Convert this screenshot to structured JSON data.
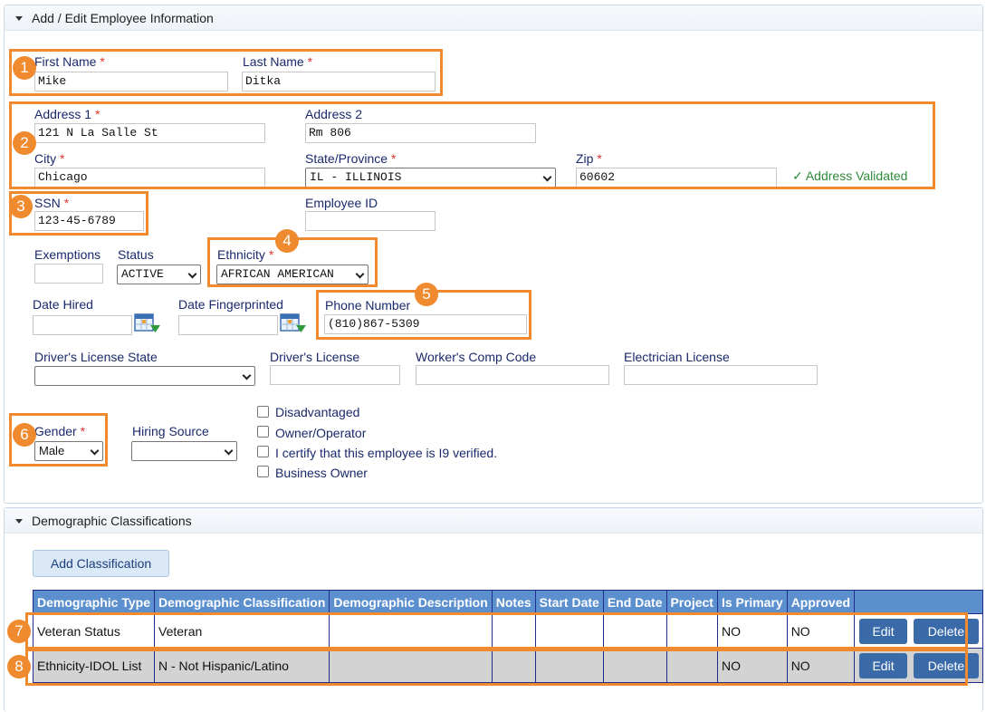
{
  "section1": {
    "title": "Add / Edit Employee Information"
  },
  "fields": {
    "first_name": {
      "label": "First Name",
      "value": "Mike"
    },
    "last_name": {
      "label": "Last Name",
      "value": "Ditka"
    },
    "address1": {
      "label": "Address 1",
      "value": "121 N La Salle St"
    },
    "address2": {
      "label": "Address 2",
      "value": "Rm 806"
    },
    "city": {
      "label": "City",
      "value": "Chicago"
    },
    "state": {
      "label": "State/Province",
      "value": "IL - ILLINOIS"
    },
    "zip": {
      "label": "Zip",
      "value": "60602"
    },
    "address_status": "✓ Address Validated",
    "ssn": {
      "label": "SSN",
      "value": "123-45-6789"
    },
    "employee_id": {
      "label": "Employee ID",
      "value": ""
    },
    "exemptions": {
      "label": "Exemptions",
      "value": ""
    },
    "status": {
      "label": "Status",
      "value": "ACTIVE"
    },
    "ethnicity": {
      "label": "Ethnicity",
      "value": "AFRICAN AMERICAN"
    },
    "date_hired": {
      "label": "Date Hired",
      "value": ""
    },
    "date_fingerprinted": {
      "label": "Date Fingerprinted",
      "value": ""
    },
    "phone": {
      "label": "Phone Number",
      "value": "(810)867-5309"
    },
    "dl_state": {
      "label": "Driver's License State",
      "value": ""
    },
    "dl": {
      "label": "Driver's License",
      "value": ""
    },
    "workers_comp": {
      "label": "Worker's Comp Code",
      "value": ""
    },
    "electrician": {
      "label": "Electrician License",
      "value": ""
    },
    "gender": {
      "label": "Gender",
      "value": "Male"
    },
    "hiring_source": {
      "label": "Hiring Source",
      "value": ""
    },
    "required_mark": "*"
  },
  "checkboxes": [
    {
      "label": "Disadvantaged",
      "checked": false
    },
    {
      "label": "Owner/Operator",
      "checked": false
    },
    {
      "label": "I certify that this employee is I9 verified.",
      "checked": false
    },
    {
      "label": "Business Owner",
      "checked": false
    }
  ],
  "section2": {
    "title": "Demographic Classifications",
    "add_button": "Add Classification",
    "columns": [
      "Demographic Type",
      "Demographic Classification",
      "Demographic Description",
      "Notes",
      "Start Date",
      "End Date",
      "Project",
      "Is Primary",
      "Approved"
    ],
    "rows": [
      {
        "type": "Veteran Status",
        "classification": "Veteran",
        "description": "",
        "notes": "",
        "start": "",
        "end": "",
        "project": "",
        "primary": "NO",
        "approved": "NO",
        "edit": "Edit",
        "delete": "Delete"
      },
      {
        "type": "Ethnicity-IDOL List",
        "classification": "N - Not Hispanic/Latino",
        "description": "",
        "notes": "",
        "start": "",
        "end": "",
        "project": "",
        "primary": "NO",
        "approved": "NO",
        "edit": "Edit",
        "delete": "Delete"
      }
    ]
  },
  "callouts": [
    "1",
    "2",
    "3",
    "4",
    "5",
    "6",
    "7",
    "8"
  ],
  "colors": {
    "highlight": "#ef8a2e",
    "table_header": "#5b8fce",
    "validated": "#2e8b3a"
  }
}
